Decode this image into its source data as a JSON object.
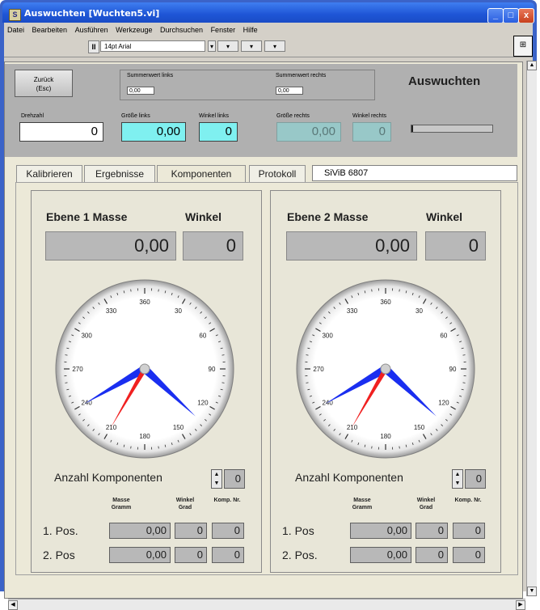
{
  "window": {
    "title": "Auswuchten [Wuchten5.vi]",
    "icon_text": "S",
    "minimize": "_",
    "maximize": "□",
    "close": "x"
  },
  "menu": [
    "Datei",
    "Bearbeiten",
    "Ausführen",
    "Werkzeuge",
    "Durchsuchen",
    "Fenster",
    "Hilfe"
  ],
  "toolbar": {
    "pause": "II",
    "font": "14pt Arial",
    "align": "▾",
    "distribute": "▾",
    "reorder": "▾",
    "corner_icon": "⊞"
  },
  "header": {
    "back_line1": "Zurück",
    "back_line2": "(Esc)",
    "sum_left_label": "Summenwert links",
    "sum_left_value": "0,00",
    "sum_right_label": "Summenwert rechts",
    "sum_right_value": "0,00",
    "title": "Auswuchten"
  },
  "readings": {
    "drehzahl_label": "Drehzahl",
    "drehzahl_value": "0",
    "groesse_links_label": "Größe links",
    "groesse_links_value": "0,00",
    "winkel_links_label": "Winkel links",
    "winkel_links_value": "0",
    "groesse_rechts_label": "Größe rechts",
    "groesse_rechts_value": "0,00",
    "winkel_rechts_label": "Winkel rechts",
    "winkel_rechts_value": "0",
    "progress_fraction": 0.0
  },
  "tabs": [
    "Kalibrieren",
    "Ergebnisse",
    "Komponenten",
    "Protokoll"
  ],
  "active_tab": "Komponenten",
  "string_control": "SiViB  6807",
  "planes": [
    {
      "masse_title": "Ebene 1 Masse",
      "winkel_title": "Winkel",
      "masse_value": "0,00",
      "winkel_value": "0",
      "dial_labels": [
        "360",
        "30",
        "60",
        "90",
        "120",
        "150",
        "180",
        "210",
        "240",
        "270",
        "300",
        "330"
      ],
      "needle_blue_angles_deg": [
        240,
        133
      ],
      "needle_red_angle_deg": 210,
      "anzahl_label": "Anzahl Komponenten",
      "anzahl_value": "0",
      "col_masse": "Masse Gramm",
      "col_winkel": "Winkel Grad",
      "col_komp": "Komp. Nr.",
      "rows": [
        {
          "label": "1. Pos.",
          "masse": "0,00",
          "winkel": "0",
          "komp": "0"
        },
        {
          "label": "2. Pos",
          "masse": "0,00",
          "winkel": "0",
          "komp": "0"
        }
      ]
    },
    {
      "masse_title": "Ebene 2 Masse",
      "winkel_title": "Winkel",
      "masse_value": "0,00",
      "winkel_value": "0",
      "dial_labels": [
        "360",
        "30",
        "60",
        "90",
        "120",
        "150",
        "180",
        "210",
        "240",
        "270",
        "300",
        "330"
      ],
      "needle_blue_angles_deg": [
        240,
        133
      ],
      "needle_red_angle_deg": 210,
      "anzahl_label": "Anzahl Komponenten",
      "anzahl_value": "0",
      "col_masse": "Masse Gramm",
      "col_winkel": "Winkel Grad",
      "col_komp": "Komp. Nr.",
      "rows": [
        {
          "label": "1. Pos",
          "masse": "0,00",
          "winkel": "0",
          "komp": "0"
        },
        {
          "label": "2. Pos.",
          "masse": "0,00",
          "winkel": "0",
          "komp": "0"
        }
      ]
    }
  ],
  "colors": {
    "titlebar": "#1e55d6",
    "cyan_indicator": "#7ff0f0",
    "needle_blue": "#1a2ef0",
    "needle_red": "#f02020"
  }
}
